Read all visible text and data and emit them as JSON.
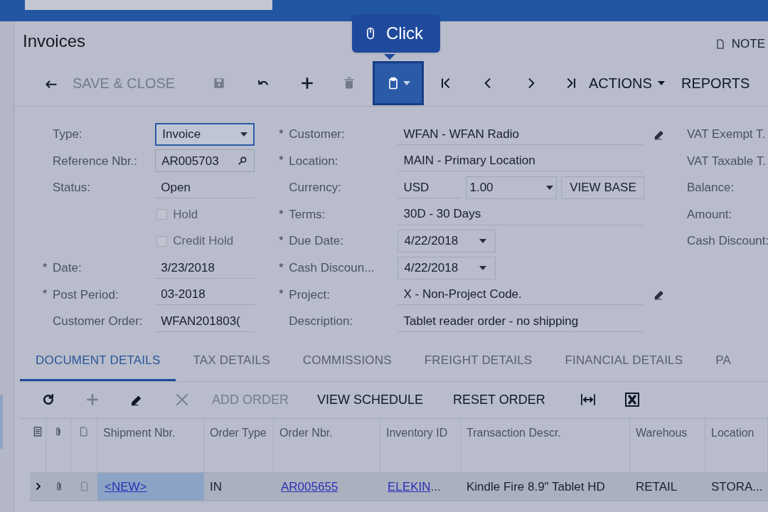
{
  "screen_title": "Invoices",
  "notes_button": "NOTE",
  "tooltip": {
    "label": "Click"
  },
  "toolbar": [
    {
      "kind": "back"
    },
    {
      "kind": "text",
      "label": "SAVE & CLOSE",
      "disabled": true
    },
    {
      "kind": "save",
      "disabled": true
    },
    {
      "kind": "undo"
    },
    {
      "kind": "add"
    },
    {
      "kind": "delete",
      "disabled": true
    },
    {
      "kind": "clipboard",
      "highlighted": true
    },
    {
      "kind": "first"
    },
    {
      "kind": "prev"
    },
    {
      "kind": "next"
    },
    {
      "kind": "last"
    },
    {
      "kind": "menu",
      "label": "ACTIONS"
    },
    {
      "kind": "text",
      "label": "REPORTS"
    }
  ],
  "form": {
    "left": [
      {
        "kind": "dropdown",
        "label": "Type:",
        "value": "Invoice",
        "focused": true
      },
      {
        "kind": "lookup",
        "label": "Reference Nbr.:",
        "value": "AR005703"
      },
      {
        "kind": "text",
        "label": "Status:",
        "value": "Open"
      },
      {
        "kind": "checkbox",
        "label": "Hold",
        "checked": false
      },
      {
        "kind": "checkbox",
        "label": "Credit Hold",
        "checked": false
      },
      {
        "kind": "text",
        "marker": "*",
        "label": "Date:",
        "value": "3/23/2018"
      },
      {
        "kind": "text",
        "marker": "*",
        "label": "Post Period:",
        "value": "03-2018"
      },
      {
        "kind": "text",
        "label": "Customer Order:",
        "value": "WFAN201803("
      }
    ],
    "middle": [
      {
        "kind": "text",
        "marker": "*",
        "label": "Customer:",
        "value": "WFAN - WFAN Radio",
        "editable": true
      },
      {
        "kind": "text",
        "marker": "*",
        "label": "Location:",
        "value": "MAIN - Primary Location"
      },
      {
        "kind": "currency",
        "label": "Currency:",
        "value": "USD",
        "rate": "1.00",
        "button": "VIEW BASE"
      },
      {
        "kind": "text",
        "marker": "*",
        "label": "Terms:",
        "value": "30D - 30 Days"
      },
      {
        "kind": "date",
        "marker": "*",
        "label": "Due Date:",
        "value": "4/22/2018"
      },
      {
        "kind": "date",
        "marker": "*",
        "label": "Cash Discoun...",
        "value": "4/22/2018"
      },
      {
        "kind": "text",
        "marker": "*",
        "label": "Project:",
        "value": "X - Non-Project Code.",
        "editable": true
      },
      {
        "kind": "text",
        "label": "Description:",
        "value": "Tablet reader order - no shipping"
      }
    ],
    "right": [
      "VAT Exempt T.",
      "VAT Taxable T.",
      "Balance:",
      "Amount:",
      "Cash Discount:"
    ]
  },
  "tabs": [
    {
      "label": "DOCUMENT DETAILS",
      "selected": true
    },
    {
      "label": "TAX DETAILS",
      "selected": false
    },
    {
      "label": "COMMISSIONS",
      "selected": false
    },
    {
      "label": "FREIGHT DETAILS",
      "selected": false
    },
    {
      "label": "FINANCIAL DETAILS",
      "selected": false
    },
    {
      "label": "PA",
      "selected": false
    }
  ],
  "grid_toolbar": [
    {
      "kind": "refresh"
    },
    {
      "kind": "add",
      "disabled": true
    },
    {
      "kind": "edit"
    },
    {
      "kind": "delete",
      "disabled": true
    },
    {
      "kind": "text",
      "label": "ADD ORDER",
      "disabled": true
    },
    {
      "kind": "text",
      "label": "VIEW SCHEDULE"
    },
    {
      "kind": "text",
      "label": "RESET ORDER"
    },
    {
      "kind": "fit"
    },
    {
      "kind": "excel"
    }
  ],
  "table": {
    "columns": [
      {
        "kind": "icon"
      },
      {
        "kind": "icon"
      },
      {
        "kind": "icon"
      },
      {
        "kind": "text",
        "label": "Shipment Nbr."
      },
      {
        "kind": "text",
        "label": "Order Type"
      },
      {
        "kind": "text",
        "label": "Order Nbr."
      },
      {
        "kind": "text",
        "label": "Inventory ID"
      },
      {
        "kind": "text",
        "label": "Transaction Descr."
      },
      {
        "kind": "text",
        "label": "Warehous"
      },
      {
        "kind": "text",
        "label": "Location"
      }
    ],
    "rows": [
      {
        "cells": [
          {
            "kind": "expand"
          },
          {
            "kind": "attach"
          },
          {
            "kind": "note"
          },
          {
            "kind": "link",
            "value": "<NEW>",
            "selected": true
          },
          {
            "kind": "text",
            "value": "IN",
            "selected": false
          },
          {
            "kind": "link",
            "value": "AR005655",
            "selected": false
          },
          {
            "kind": "link",
            "value": "ELEKIN",
            "suffix": "...",
            "selected": false
          },
          {
            "kind": "text",
            "value": "Kindle Fire 8.9\" Tablet HD",
            "selected": false
          },
          {
            "kind": "text",
            "value": "RETAIL",
            "selected": false
          },
          {
            "kind": "text",
            "value": "STORA...",
            "selected": false
          }
        ]
      }
    ]
  }
}
